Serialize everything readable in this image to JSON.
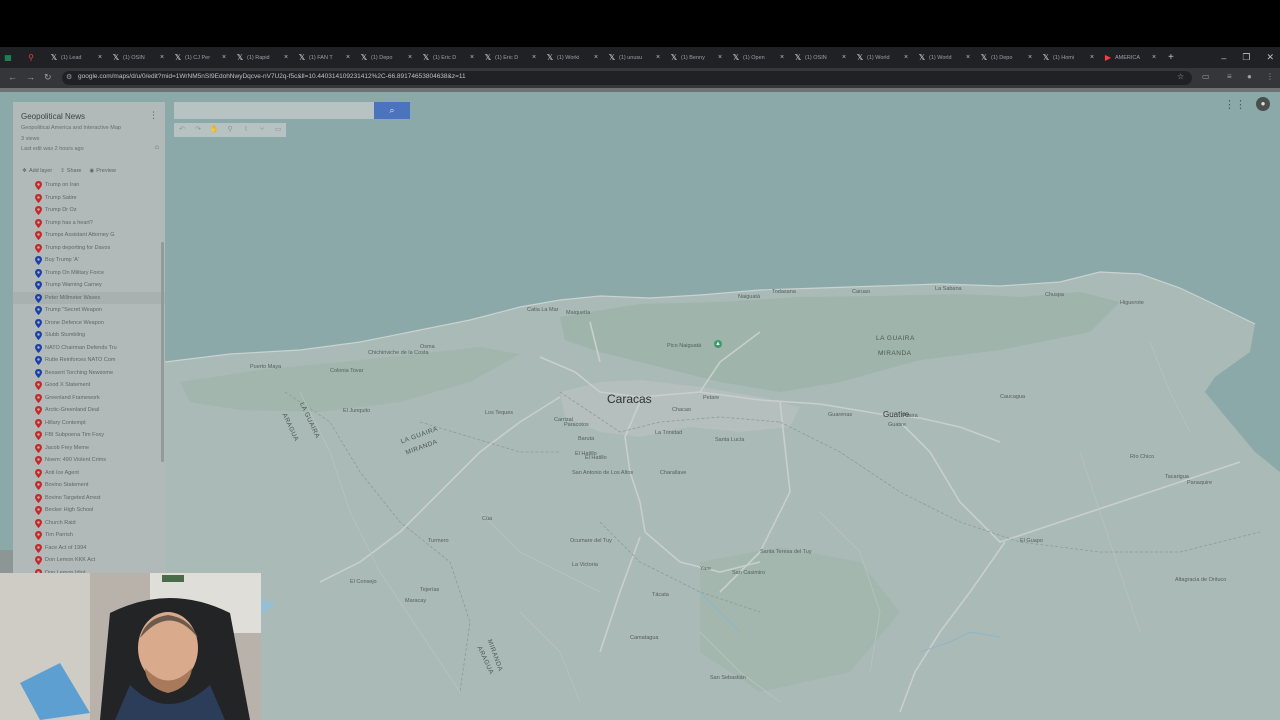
{
  "browser": {
    "tabs": [
      {
        "label": "",
        "icon": "sheets-icon"
      },
      {
        "label": "",
        "icon": "maps-pin-icon"
      },
      {
        "label": "(1) Lead",
        "icon": "x-icon"
      },
      {
        "label": "(1) OSIN",
        "icon": "x-icon"
      },
      {
        "label": "(1) CJ Per",
        "icon": "x-icon"
      },
      {
        "label": "(1) Rapid",
        "icon": "x-icon"
      },
      {
        "label": "(1) FAN T",
        "icon": "x-icon"
      },
      {
        "label": "(1) Depo",
        "icon": "x-icon"
      },
      {
        "label": "(1) Eric D",
        "icon": "x-icon"
      },
      {
        "label": "(1) Eric D",
        "icon": "x-icon"
      },
      {
        "label": "(1) Worki",
        "icon": "x-icon"
      },
      {
        "label": "(1) unusu",
        "icon": "x-icon"
      },
      {
        "label": "(1) Benny",
        "icon": "x-icon"
      },
      {
        "label": "(1) Open",
        "icon": "x-icon"
      },
      {
        "label": "(1) OSIN",
        "icon": "x-icon"
      },
      {
        "label": "(1) World",
        "icon": "x-icon"
      },
      {
        "label": "(1) World",
        "icon": "x-icon"
      },
      {
        "label": "(1) Depo",
        "icon": "x-icon"
      },
      {
        "label": "(1) Homi",
        "icon": "x-icon"
      },
      {
        "label": "AMERICA",
        "icon": "youtube-icon"
      }
    ],
    "url": "google.com/maps/d/u/0/edit?mid=1WrNM5nSI9EdohNwyDqcve-nV7U2q-f5c&ll=10.440314109231412%2C-66.89174653804638&z=11"
  },
  "map_panel": {
    "title": "Geopolitical News",
    "description": "Geopolitical America and Interactive Map",
    "views": "3 views",
    "last_edit": "Last edit was 2 hours ago",
    "actions": {
      "add_layer": "Add layer",
      "share": "Share",
      "preview": "Preview"
    },
    "items": [
      {
        "label": "Trump on Iran",
        "color": "#c62828"
      },
      {
        "label": "Trump Satire",
        "color": "#c62828"
      },
      {
        "label": "Trump Dr Oz",
        "color": "#c62828"
      },
      {
        "label": "Trump has a heart?",
        "color": "#c62828"
      },
      {
        "label": "Trumps Assistant Attorney G",
        "color": "#c62828"
      },
      {
        "label": "Trump deporting for Davos",
        "color": "#c62828"
      },
      {
        "label": "Buy Trump 'A'",
        "color": "#1a3fa8"
      },
      {
        "label": "Trump On Military Force",
        "color": "#1a3fa8"
      },
      {
        "label": "Trump Warning Carney",
        "color": "#1a3fa8"
      },
      {
        "label": "Peter Millmeter Waves",
        "color": "#1a3fa8"
      },
      {
        "label": "Trump \"Secret Weapon",
        "color": "#1a3fa8"
      },
      {
        "label": "Drone Defence Weapon",
        "color": "#1a3fa8"
      },
      {
        "label": "Slubb Stumbling",
        "color": "#1a3fa8"
      },
      {
        "label": "NATO Chairman Defends Tru",
        "color": "#1a3fa8"
      },
      {
        "label": "Rutte Reinforces NATO Com",
        "color": "#1a3fa8"
      },
      {
        "label": "Bessent Torching Newsome",
        "color": "#1a3fa8"
      },
      {
        "label": "Good X Statement",
        "color": "#c62828"
      },
      {
        "label": "Greenland Framework",
        "color": "#c62828"
      },
      {
        "label": "Arctic-Greenland Deal",
        "color": "#c62828"
      },
      {
        "label": "Hillary Contempt",
        "color": "#c62828"
      },
      {
        "label": "FBI Subpoena Tim Foxy",
        "color": "#c62828"
      },
      {
        "label": "Jacob Frey Meme",
        "color": "#c62828"
      },
      {
        "label": "Noem: 490 Violent Crims",
        "color": "#c62828"
      },
      {
        "label": "Anti Ice Agent",
        "color": "#c62828"
      },
      {
        "label": "Bovino Statement",
        "color": "#c62828"
      },
      {
        "label": "Bovino Targeted Arrest",
        "color": "#c62828"
      },
      {
        "label": "Becker High School",
        "color": "#c62828"
      },
      {
        "label": "Church Raid",
        "color": "#c62828"
      },
      {
        "label": "Tim Parrish",
        "color": "#c62828"
      },
      {
        "label": "Face Act of 1994",
        "color": "#c62828"
      },
      {
        "label": "Don Lemon KKK Act",
        "color": "#c62828"
      },
      {
        "label": "Don Lemon Idiot",
        "color": "#c62828"
      }
    ]
  },
  "map": {
    "search_placeholder": "",
    "tools": [
      "undo-icon",
      "redo-icon",
      "hand-icon",
      "marker-icon",
      "line-icon",
      "route-icon",
      "ruler-icon"
    ],
    "main_city": "Caracas",
    "city2": "Guatire",
    "regions": [
      "LA GUAIRA",
      "MIRANDA",
      "LA GUAIRA",
      "LA GUAIRA",
      "MIRANDA",
      "ARAGUA",
      "ARAGUA",
      "MIRANDA"
    ],
    "poi": "Pico Naiguatá",
    "places": [
      "Maiquetía",
      "Catia La Mar",
      "Naiguatá",
      "Chichiriviche de la Costa",
      "Osma",
      "Todasana",
      "La Sabana",
      "Caruao",
      "Chuspa",
      "Higuerote",
      "Puerto Maya",
      "Colonia Tovar",
      "El Junquito",
      "Los Teques",
      "San Antonio de Los Altos",
      "Charallave",
      "Santa Teresa del Tuy",
      "Ocumare del Tuy",
      "Cúa",
      "Petare",
      "Baruta",
      "El Hatillo",
      "Guarenas",
      "Araira",
      "Caucagua",
      "El Guapo",
      "Río Chico",
      "Tacarigua",
      "Panaquire",
      "Altagracia de Orituco",
      "San Casimiro",
      "San Sebastián",
      "Camatagua",
      "La Victoria",
      "El Consejo",
      "Tejerías",
      "Turmero",
      "Maracay",
      "Paracotos",
      "Tácata",
      "Santa Lucía",
      "Yare",
      "La Trinidad",
      "Chacao",
      "El Hatillo",
      "Carrizal",
      "Guatire"
    ]
  },
  "webcam": {
    "label": "streamer-webcam"
  }
}
